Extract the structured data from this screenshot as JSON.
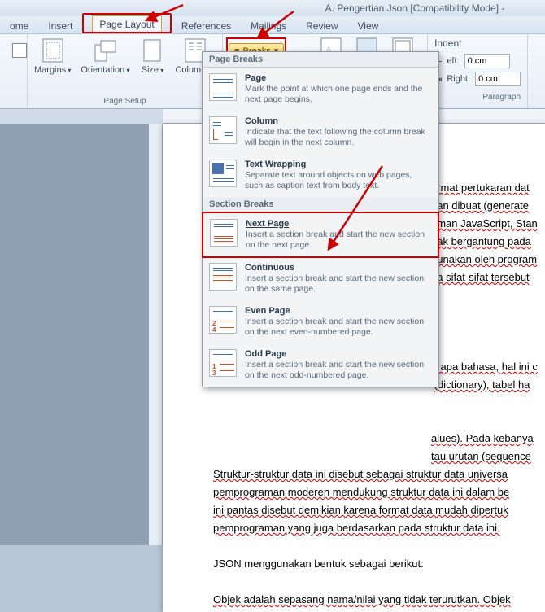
{
  "title": "A. Pengertian Json [Compatibility Mode] -",
  "tabs": [
    "ome",
    "Insert",
    "Page Layout",
    "References",
    "Mailings",
    "Review",
    "View"
  ],
  "active_tab": "Page Layout",
  "ribbon": {
    "page_setup": {
      "label": "Page Setup",
      "margins": "Margins",
      "orientation": "Orientation",
      "size": "Size",
      "columns": "Columns",
      "breaks": "Breaks"
    },
    "paragraph": {
      "label": "Paragraph",
      "indent": "Indent",
      "left": "eft:",
      "right": "Right:",
      "left_val": "0 cm",
      "right_val": "0 cm"
    }
  },
  "dropdown": {
    "page_breaks_hdr": "Page Breaks",
    "section_breaks_hdr": "Section Breaks",
    "items": [
      {
        "title": "Page",
        "desc": "Mark the point at which one page ends and the next page begins."
      },
      {
        "title": "Column",
        "desc": "Indicate that the text following the column break will begin in the next column."
      },
      {
        "title": "Text Wrapping",
        "desc": "Separate text around objects on web pages, such as caption text from body text."
      },
      {
        "title": "Next Page",
        "desc": "Insert a section break and start the new section on the next page."
      },
      {
        "title": "Continuous",
        "desc": "Insert a section break and start the new section on the same page."
      },
      {
        "title": "Even Page",
        "desc": "Insert a section break and start the new section on the next even-numbered page."
      },
      {
        "title": "Odd Page",
        "desc": "Insert a section break and start the new section on the next odd-numbered page."
      }
    ]
  },
  "doc": {
    "p1_l1": "ormat pertukaran dat",
    "p1_l2": "dan dibuat (generate",
    "p1_l3": "aman JavaScript, Stan",
    "p1_l4": "dak bergantung pada",
    "p1_l5": "gunakan oleh program",
    "p1_l6": "na sifat-sifat tersebut",
    "p2_l1": "erapa bahasa, hal ini c",
    "p2_l2": "(dictionary), tabel ha",
    "p2_l3": "alues). Pada kebanya",
    "p2_l4": "tau urutan (sequence",
    "p3": "Struktur-struktur data ini disebut sebagai struktur data universa",
    "p4": "pemprograman moderen mendukung struktur data ini dalam be",
    "p5": "ini pantas disebut demikian karena format data mudah dipertuk",
    "p6": "pemprograman yang juga berdasarkan pada struktur data ini.",
    "p7": "JSON menggunakan bentuk sebagai berikut:",
    "p8": "Objek adalah sepasang nama/nilai yang tidak terurutkan. Objek"
  }
}
